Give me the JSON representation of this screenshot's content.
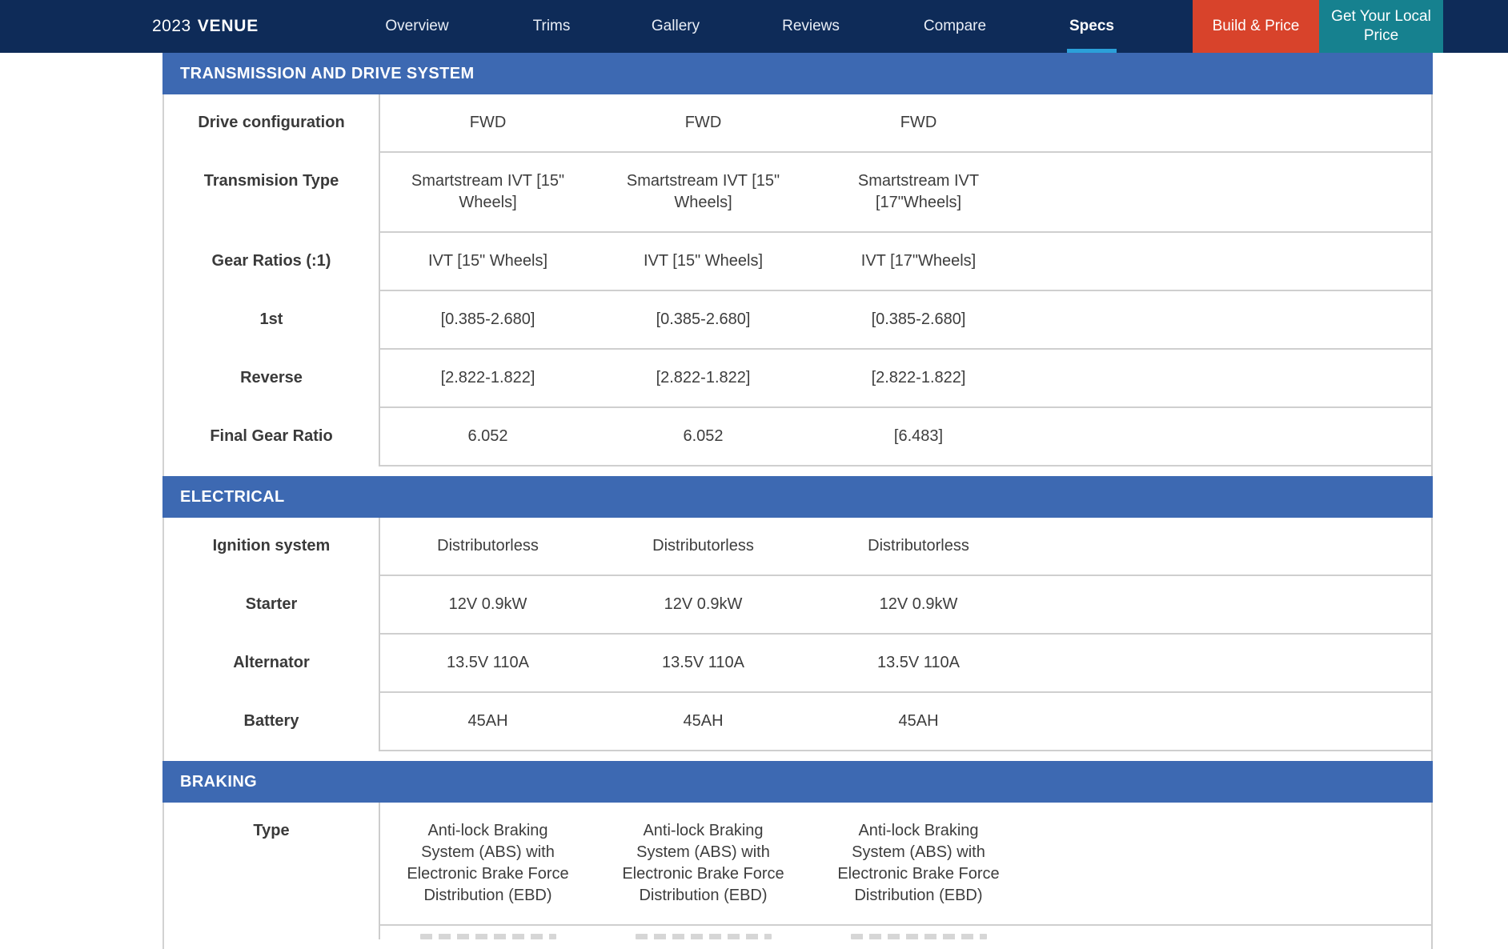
{
  "nav": {
    "brand": {
      "year": "2023",
      "model": "VENUE"
    },
    "links": [
      {
        "label": "Overview",
        "active": false
      },
      {
        "label": "Trims",
        "active": false
      },
      {
        "label": "Gallery",
        "active": false
      },
      {
        "label": "Reviews",
        "active": false
      },
      {
        "label": "Compare",
        "active": false
      },
      {
        "label": "Specs",
        "active": true
      }
    ],
    "buttons": [
      {
        "label": "Build & Price"
      },
      {
        "label": "Get Your Local Price"
      }
    ]
  },
  "colors": {
    "nav_bg": "#0e2b58",
    "section_header_bg": "#3d69b2",
    "build_price_bg": "#d8432b",
    "local_price_bg": "#16818f",
    "active_tab_underline": "#2ba0d9",
    "body_text": "#3d3d3d",
    "grid_line": "#cfcfcf"
  },
  "spec_table": {
    "sections": [
      {
        "title": "TRANSMISSION AND DRIVE SYSTEM",
        "rows": [
          {
            "label": "Drive configuration",
            "values": [
              "FWD",
              "FWD",
              "FWD"
            ]
          },
          {
            "label": "Transmision Type",
            "values": [
              "Smartstream IVT [15\" Wheels]",
              "Smartstream IVT [15\" Wheels]",
              "Smartstream IVT [17\"Wheels]"
            ]
          },
          {
            "label": "Gear Ratios (:1)",
            "values": [
              "IVT [15\" Wheels]",
              "IVT [15\" Wheels]",
              "IVT [17\"Wheels]"
            ]
          },
          {
            "label": "1st",
            "values": [
              "[0.385-2.680]",
              "[0.385-2.680]",
              "[0.385-2.680]"
            ]
          },
          {
            "label": "Reverse",
            "values": [
              "[2.822-1.822]",
              "[2.822-1.822]",
              "[2.822-1.822]"
            ]
          },
          {
            "label": "Final Gear Ratio",
            "values": [
              "6.052",
              "6.052",
              "[6.483]"
            ]
          }
        ]
      },
      {
        "title": "ELECTRICAL",
        "rows": [
          {
            "label": "Ignition system",
            "values": [
              "Distributorless",
              "Distributorless",
              "Distributorless"
            ]
          },
          {
            "label": "Starter",
            "values": [
              "12V 0.9kW",
              "12V 0.9kW",
              "12V 0.9kW"
            ]
          },
          {
            "label": "Alternator",
            "values": [
              "13.5V 110A",
              "13.5V 110A",
              "13.5V 110A"
            ]
          },
          {
            "label": "Battery",
            "values": [
              "45AH",
              "45AH",
              "45AH"
            ]
          }
        ]
      },
      {
        "title": "BRAKING",
        "rows": [
          {
            "label": "Type",
            "values": [
              "Anti-lock Braking System (ABS) with Electronic Brake Force Distribution (EBD)",
              "Anti-lock Braking System (ABS) with Electronic Brake Force Distribution (EBD)",
              "Anti-lock Braking System (ABS) with Electronic Brake Force Distribution (EBD)"
            ]
          }
        ]
      }
    ]
  }
}
